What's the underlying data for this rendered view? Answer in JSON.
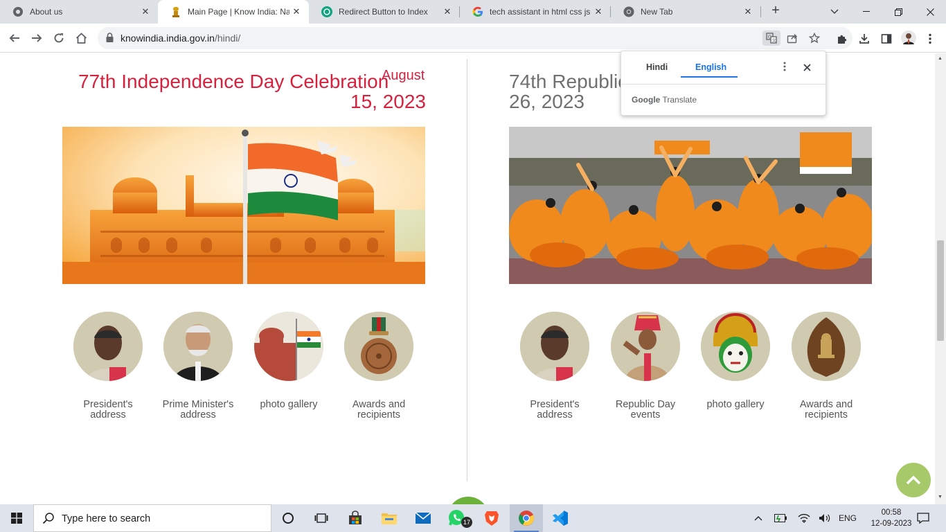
{
  "browser": {
    "tabs": [
      {
        "title": "About us",
        "icon": "chrome-globe-icon"
      },
      {
        "title": "Main Page | Know India: Nati",
        "icon": "ashoka-emblem-icon",
        "active": true
      },
      {
        "title": "Redirect Button to Index",
        "icon": "chatgpt-icon"
      },
      {
        "title": "tech assistant in html css js g",
        "icon": "google-icon"
      },
      {
        "title": "New Tab",
        "icon": "chrome-icon"
      }
    ],
    "close_glyph": "✕",
    "new_tab_glyph": "+",
    "url_host": "knowindia.india.gov.in",
    "url_path": "/hindi/"
  },
  "translate_popup": {
    "tab_source": "Hindi",
    "tab_target": "English",
    "brand": "Google",
    "brand_suffix": " Translate"
  },
  "left_section": {
    "title_main": "77th Independence Day Celebration",
    "title_month": "August",
    "title_date": "15, 2023",
    "image_alt": "Red Fort with Indian flag",
    "items": [
      {
        "label": "President's address",
        "icon": "president-portrait-icon"
      },
      {
        "label": "Prime Minister's address",
        "icon": "prime-minister-portrait-icon"
      },
      {
        "label": "photo gallery",
        "icon": "red-fort-flag-icon"
      },
      {
        "label": "Awards and recipients",
        "icon": "medal-icon"
      }
    ]
  },
  "right_section": {
    "title_line1": "74th Republic",
    "title_line2": "26, 2023",
    "image_alt": "Republic Day dancers in saffron",
    "items": [
      {
        "label": "President's address",
        "icon": "president-portrait-icon"
      },
      {
        "label": "Republic Day events",
        "icon": "soldier-salute-icon"
      },
      {
        "label": "photo gallery",
        "icon": "kathakali-mask-icon"
      },
      {
        "label": "Awards and recipients",
        "icon": "bodhi-leaf-emblem-icon"
      }
    ]
  },
  "taskbar": {
    "search_placeholder": "Type here to search",
    "whatsapp_badge": "17",
    "language": "ENG",
    "time": "00:58",
    "date": "12-09-2023"
  },
  "colors": {
    "accent_red": "#d6223e",
    "saffron": "#f08a1c",
    "scroll_up_bg": "#a8c96a",
    "translate_blue": "#1a73e8"
  }
}
